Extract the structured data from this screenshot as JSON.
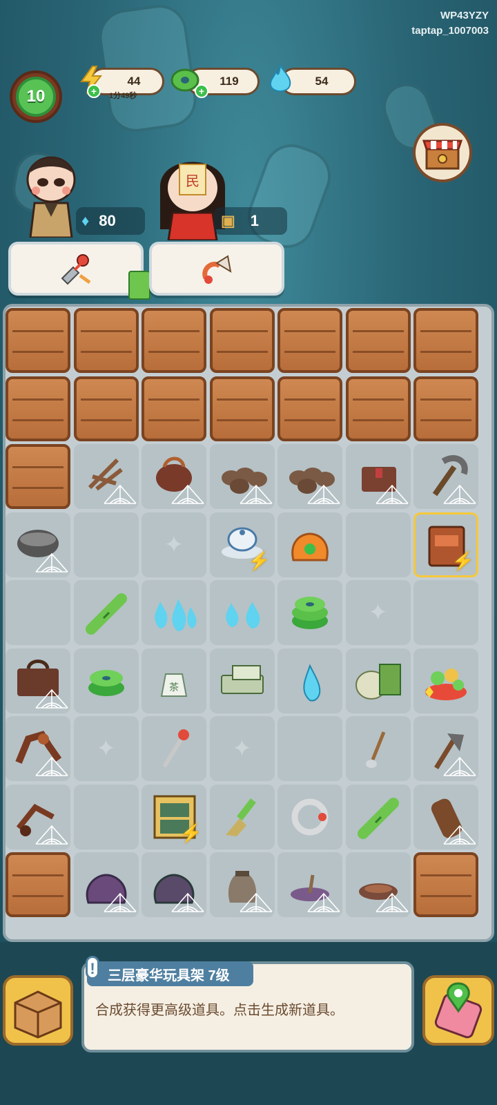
{
  "corner": {
    "line1": "WP43YZY",
    "line2": "taptap_1007003"
  },
  "player": {
    "level": "10"
  },
  "resources": {
    "energy": {
      "value": "44",
      "timer": "1分49秒",
      "icon": "lightning-icon"
    },
    "coins": {
      "value": "119",
      "icon": "jade-coin-icon"
    },
    "flames": {
      "value": "54",
      "icon": "blue-flame-icon"
    }
  },
  "characters": {
    "left_counter": "80",
    "right_counter": "1"
  },
  "info": {
    "title": "三层豪华玩具架 7级",
    "description": "合成获得更高级道具。点击生成新道具。"
  },
  "colors": {
    "crate": "#c07840",
    "tile": "#b6c2c6",
    "accent_green": "#58c255",
    "panel_blue": "#4f7fa0"
  },
  "grid": {
    "rows": 9,
    "cols": 7,
    "cells": [
      [
        "crate",
        "crate",
        "crate",
        "crate",
        "crate",
        "crate",
        "crate"
      ],
      [
        "crate",
        "crate",
        "crate",
        "crate",
        "crate",
        "crate",
        "crate"
      ],
      [
        "crate",
        "webbed:sticks",
        "webbed:bag",
        "webbed:buns",
        "webbed:buns",
        "webbed:chest",
        "webbed:pickaxe"
      ],
      [
        "webbed:pot",
        "empty",
        "sparkle",
        "teaset",
        "lucky-bag",
        "empty",
        "cabinet"
      ],
      [
        "empty",
        "bamboo",
        "blue-flames",
        "blue-flames-2",
        "jade-coins",
        "sparkle",
        "empty"
      ],
      [
        "webbed:trunk",
        "jade-coins-2",
        "tea-bag",
        "tea-box",
        "blue-flame",
        "tea-brick",
        "treasure-bowl"
      ],
      [
        "webbed:horse",
        "sparkle",
        "chisel",
        "sparkle",
        "empty",
        "spoon",
        "webbed:axe"
      ],
      [
        "webbed:wheelbarrow",
        "empty",
        "toy-shelf",
        "brush",
        "ring",
        "bamboo-2",
        "webbed:drum"
      ],
      [
        "crate",
        "webbed:sack",
        "webbed:sack-2",
        "webbed:jar",
        "webbed:incense",
        "webbed:bowl",
        "crate"
      ]
    ]
  }
}
